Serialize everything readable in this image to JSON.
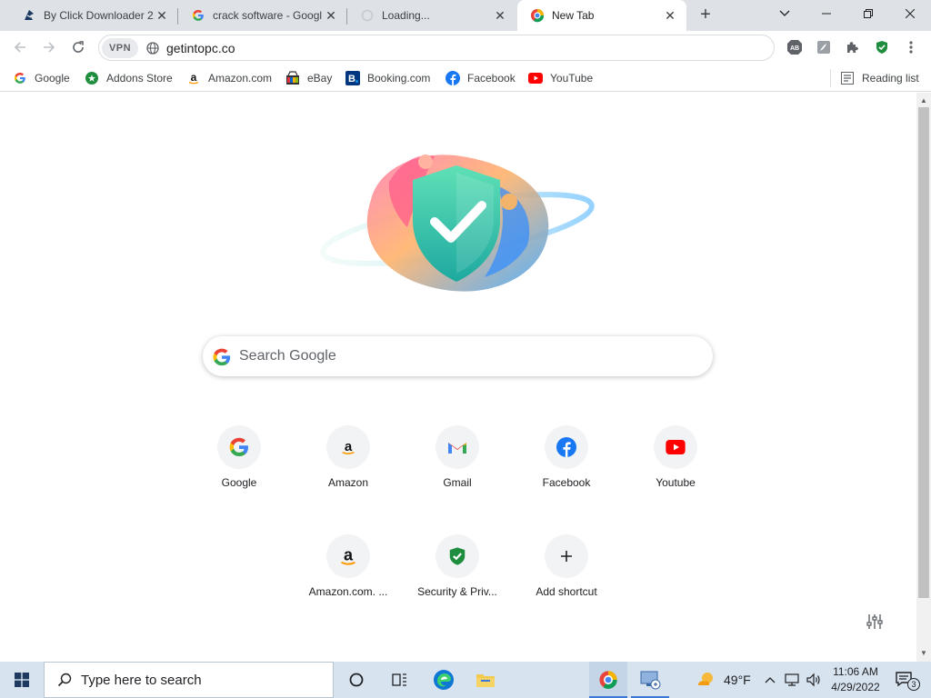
{
  "tabs": [
    {
      "title": "By Click Downloader 2.",
      "active": false
    },
    {
      "title": "crack software - Googl",
      "active": false
    },
    {
      "title": "Loading...",
      "active": false
    },
    {
      "title": "New Tab",
      "active": true
    }
  ],
  "toolbar": {
    "vpn_label": "VPN",
    "url": "getintopc.co"
  },
  "bookmarks": [
    {
      "label": "Google",
      "icon": "google-icon"
    },
    {
      "label": "Addons Store",
      "icon": "addons-store-icon"
    },
    {
      "label": "Amazon.com",
      "icon": "amazon-icon"
    },
    {
      "label": "eBay",
      "icon": "ebay-icon"
    },
    {
      "label": "Booking.com",
      "icon": "booking-icon"
    },
    {
      "label": "Facebook",
      "icon": "facebook-icon"
    },
    {
      "label": "YouTube",
      "icon": "youtube-icon"
    }
  ],
  "reading_list": "Reading list",
  "search": {
    "placeholder": "Search Google"
  },
  "shortcuts": [
    {
      "label": "Google",
      "icon": "google-icon"
    },
    {
      "label": "Amazon",
      "icon": "amazon-icon"
    },
    {
      "label": "Gmail",
      "icon": "gmail-icon"
    },
    {
      "label": "Facebook",
      "icon": "facebook-icon"
    },
    {
      "label": "Youtube",
      "icon": "youtube-icon"
    },
    {
      "label": "Amazon.com. ...",
      "icon": "amazon-icon"
    },
    {
      "label": "Security & Priv...",
      "icon": "shield-check-icon"
    },
    {
      "label": "Add shortcut",
      "icon": "plus-icon"
    }
  ],
  "taskbar": {
    "search_placeholder": "Type here to search",
    "weather": "49°F",
    "time": "11:06 AM",
    "date": "4/29/2022",
    "notifications": "3"
  },
  "colors": {
    "tabstrip": "#dee1e6",
    "accent_blue": "#1a73e8",
    "taskbar": "#d7e3ef"
  }
}
